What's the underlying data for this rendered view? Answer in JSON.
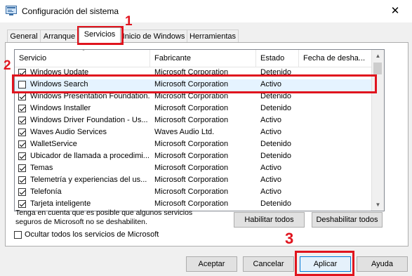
{
  "window": {
    "title": "Configuración del sistema",
    "close_glyph": "✕"
  },
  "tabs": [
    {
      "label": "General"
    },
    {
      "label": "Arranque"
    },
    {
      "label": "Servicios",
      "active": true
    },
    {
      "label": "Inicio de Windows"
    },
    {
      "label": "Herramientas"
    }
  ],
  "table": {
    "headers": [
      "Servicio",
      "Fabricante",
      "Estado",
      "Fecha de desha..."
    ],
    "rows": [
      {
        "name": "Windows Update",
        "maker": "Microsoft Corporation",
        "state": "Detenido",
        "checked": true
      },
      {
        "name": "Windows Search",
        "maker": "Microsoft Corporation",
        "state": "Activo",
        "checked": false
      },
      {
        "name": "Windows Presentation Foundation...",
        "maker": "Microsoft Corporation",
        "state": "Detenido",
        "checked": true
      },
      {
        "name": "Windows Installer",
        "maker": "Microsoft Corporation",
        "state": "Detenido",
        "checked": true
      },
      {
        "name": "Windows Driver Foundation - Us...",
        "maker": "Microsoft Corporation",
        "state": "Activo",
        "checked": true
      },
      {
        "name": "Waves Audio Services",
        "maker": "Waves Audio Ltd.",
        "state": "Activo",
        "checked": true
      },
      {
        "name": "WalletService",
        "maker": "Microsoft Corporation",
        "state": "Detenido",
        "checked": true
      },
      {
        "name": "Ubicador de llamada a procedimi...",
        "maker": "Microsoft Corporation",
        "state": "Detenido",
        "checked": true
      },
      {
        "name": "Temas",
        "maker": "Microsoft Corporation",
        "state": "Activo",
        "checked": true
      },
      {
        "name": "Telemetría y experiencias del us...",
        "maker": "Microsoft Corporation",
        "state": "Activo",
        "checked": true
      },
      {
        "name": "Telefonía",
        "maker": "Microsoft Corporation",
        "state": "Activo",
        "checked": true
      },
      {
        "name": "Tarjeta inteligente",
        "maker": "Microsoft Corporation",
        "state": "Detenido",
        "checked": true
      }
    ]
  },
  "note": {
    "line1": "Tenga en cuenta que es posible que algunos servicios",
    "line2": "seguros de Microsoft no se deshabiliten."
  },
  "buttons": {
    "enable_all": "Habilitar todos",
    "disable_all": "Deshabilitar todos",
    "accept": "Aceptar",
    "cancel": "Cancelar",
    "apply": "Aplicar",
    "help": "Ayuda"
  },
  "hide_ms": {
    "label": "Ocultar todos los servicios de Microsoft",
    "checked": false
  },
  "annotations": {
    "step1": "1",
    "step2": "2",
    "step3": "3"
  },
  "colors": {
    "annotation": "#e0141e",
    "selection": "#e5f3ff"
  },
  "icons": {
    "app": "msconfig-icon",
    "scroll_up": "scroll-up-arrow-icon",
    "scroll_down": "scroll-down-arrow-icon"
  }
}
